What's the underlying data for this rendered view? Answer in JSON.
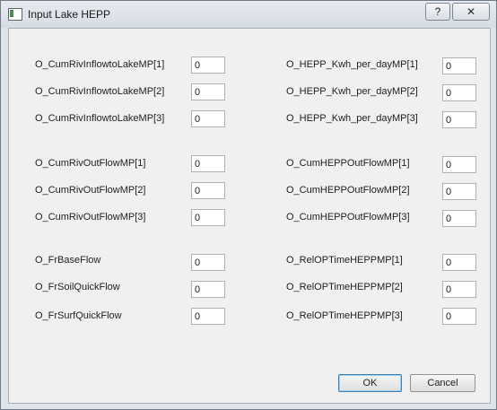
{
  "window": {
    "title": "Input Lake HEPP",
    "help_label": "?",
    "close_label": "✕"
  },
  "left": [
    {
      "label": "O_CumRivInflowtoLakeMP[1]",
      "value": "0"
    },
    {
      "label": "O_CumRivInflowtoLakeMP[2]",
      "value": "0"
    },
    {
      "label": "O_CumRivInflowtoLakeMP[3]",
      "value": "0"
    },
    {
      "label": "O_CumRivOutFlowMP[1]",
      "value": "0"
    },
    {
      "label": "O_CumRivOutFlowMP[2]",
      "value": "0"
    },
    {
      "label": "O_CumRivOutFlowMP[3]",
      "value": "0"
    },
    {
      "label": "O_FrBaseFlow",
      "value": "0"
    },
    {
      "label": "O_FrSoilQuickFlow",
      "value": "0"
    },
    {
      "label": "O_FrSurfQuickFlow",
      "value": "0"
    }
  ],
  "right": [
    {
      "label": "O_HEPP_Kwh_per_dayMP[1]",
      "value": "0"
    },
    {
      "label": "O_HEPP_Kwh_per_dayMP[2]",
      "value": "0"
    },
    {
      "label": "O_HEPP_Kwh_per_dayMP[3]",
      "value": "0"
    },
    {
      "label": "O_CumHEPPOutFlowMP[1]",
      "value": "0"
    },
    {
      "label": "O_CumHEPPOutFlowMP[2]",
      "value": "0"
    },
    {
      "label": "O_CumHEPPOutFlowMP[3]",
      "value": "0"
    },
    {
      "label": "O_RelOPTimeHEPPMP[1]",
      "value": "0"
    },
    {
      "label": "O_RelOPTimeHEPPMP[2]",
      "value": "0"
    },
    {
      "label": "O_RelOPTimeHEPPMP[3]",
      "value": "0"
    }
  ],
  "buttons": {
    "ok_label": "OK",
    "cancel_label": "Cancel"
  }
}
